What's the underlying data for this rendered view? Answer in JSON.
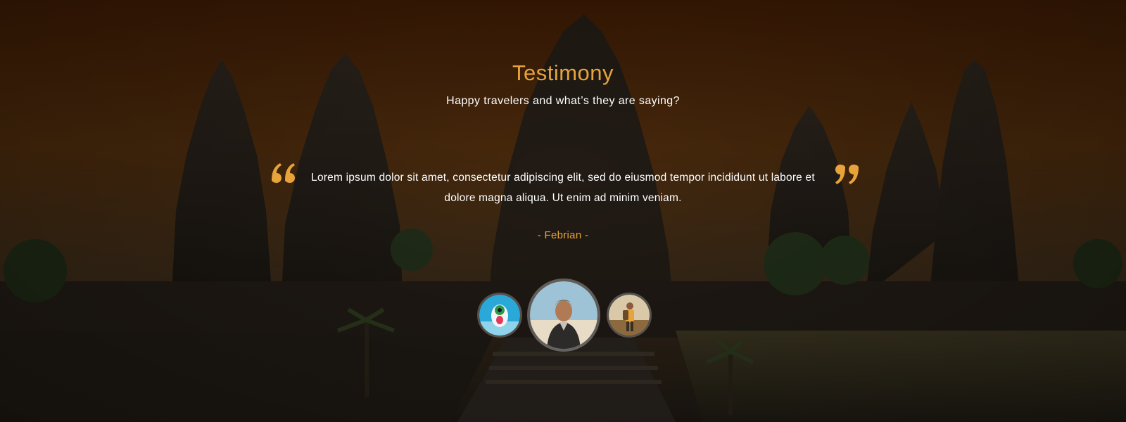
{
  "section": {
    "title": "Testimony",
    "subtitle": "Happy travelers and what’s they are saying?"
  },
  "testimonial": {
    "quote": "Lorem ipsum dolor sit amet, consectetur adipiscing elit, sed do eiusmod tempor incididunt ut labore et dolore magna aliqua. Ut enim ad minim veniam.",
    "author": "- Febrian -"
  },
  "avatars": [
    {
      "name": "avatar-bird",
      "selected": false
    },
    {
      "name": "avatar-febrian",
      "selected": true
    },
    {
      "name": "avatar-backpacker",
      "selected": false
    }
  ],
  "colors": {
    "accent": "#e8a33a",
    "text": "#ffffff"
  },
  "icons": {
    "open_quote": "open-quote-icon",
    "close_quote": "close-quote-icon"
  }
}
